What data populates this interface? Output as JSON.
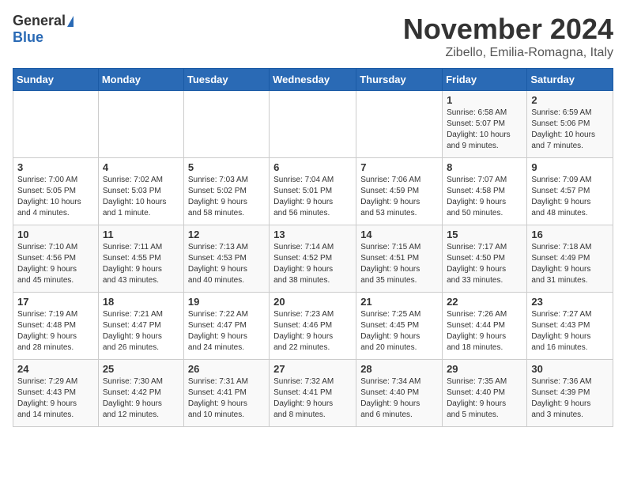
{
  "logo": {
    "general": "General",
    "blue": "Blue"
  },
  "title": "November 2024",
  "subtitle": "Zibello, Emilia-Romagna, Italy",
  "days_of_week": [
    "Sunday",
    "Monday",
    "Tuesday",
    "Wednesday",
    "Thursday",
    "Friday",
    "Saturday"
  ],
  "weeks": [
    [
      {
        "day": "",
        "info": ""
      },
      {
        "day": "",
        "info": ""
      },
      {
        "day": "",
        "info": ""
      },
      {
        "day": "",
        "info": ""
      },
      {
        "day": "",
        "info": ""
      },
      {
        "day": "1",
        "info": "Sunrise: 6:58 AM\nSunset: 5:07 PM\nDaylight: 10 hours\nand 9 minutes."
      },
      {
        "day": "2",
        "info": "Sunrise: 6:59 AM\nSunset: 5:06 PM\nDaylight: 10 hours\nand 7 minutes."
      }
    ],
    [
      {
        "day": "3",
        "info": "Sunrise: 7:00 AM\nSunset: 5:05 PM\nDaylight: 10 hours\nand 4 minutes."
      },
      {
        "day": "4",
        "info": "Sunrise: 7:02 AM\nSunset: 5:03 PM\nDaylight: 10 hours\nand 1 minute."
      },
      {
        "day": "5",
        "info": "Sunrise: 7:03 AM\nSunset: 5:02 PM\nDaylight: 9 hours\nand 58 minutes."
      },
      {
        "day": "6",
        "info": "Sunrise: 7:04 AM\nSunset: 5:01 PM\nDaylight: 9 hours\nand 56 minutes."
      },
      {
        "day": "7",
        "info": "Sunrise: 7:06 AM\nSunset: 4:59 PM\nDaylight: 9 hours\nand 53 minutes."
      },
      {
        "day": "8",
        "info": "Sunrise: 7:07 AM\nSunset: 4:58 PM\nDaylight: 9 hours\nand 50 minutes."
      },
      {
        "day": "9",
        "info": "Sunrise: 7:09 AM\nSunset: 4:57 PM\nDaylight: 9 hours\nand 48 minutes."
      }
    ],
    [
      {
        "day": "10",
        "info": "Sunrise: 7:10 AM\nSunset: 4:56 PM\nDaylight: 9 hours\nand 45 minutes."
      },
      {
        "day": "11",
        "info": "Sunrise: 7:11 AM\nSunset: 4:55 PM\nDaylight: 9 hours\nand 43 minutes."
      },
      {
        "day": "12",
        "info": "Sunrise: 7:13 AM\nSunset: 4:53 PM\nDaylight: 9 hours\nand 40 minutes."
      },
      {
        "day": "13",
        "info": "Sunrise: 7:14 AM\nSunset: 4:52 PM\nDaylight: 9 hours\nand 38 minutes."
      },
      {
        "day": "14",
        "info": "Sunrise: 7:15 AM\nSunset: 4:51 PM\nDaylight: 9 hours\nand 35 minutes."
      },
      {
        "day": "15",
        "info": "Sunrise: 7:17 AM\nSunset: 4:50 PM\nDaylight: 9 hours\nand 33 minutes."
      },
      {
        "day": "16",
        "info": "Sunrise: 7:18 AM\nSunset: 4:49 PM\nDaylight: 9 hours\nand 31 minutes."
      }
    ],
    [
      {
        "day": "17",
        "info": "Sunrise: 7:19 AM\nSunset: 4:48 PM\nDaylight: 9 hours\nand 28 minutes."
      },
      {
        "day": "18",
        "info": "Sunrise: 7:21 AM\nSunset: 4:47 PM\nDaylight: 9 hours\nand 26 minutes."
      },
      {
        "day": "19",
        "info": "Sunrise: 7:22 AM\nSunset: 4:47 PM\nDaylight: 9 hours\nand 24 minutes."
      },
      {
        "day": "20",
        "info": "Sunrise: 7:23 AM\nSunset: 4:46 PM\nDaylight: 9 hours\nand 22 minutes."
      },
      {
        "day": "21",
        "info": "Sunrise: 7:25 AM\nSunset: 4:45 PM\nDaylight: 9 hours\nand 20 minutes."
      },
      {
        "day": "22",
        "info": "Sunrise: 7:26 AM\nSunset: 4:44 PM\nDaylight: 9 hours\nand 18 minutes."
      },
      {
        "day": "23",
        "info": "Sunrise: 7:27 AM\nSunset: 4:43 PM\nDaylight: 9 hours\nand 16 minutes."
      }
    ],
    [
      {
        "day": "24",
        "info": "Sunrise: 7:29 AM\nSunset: 4:43 PM\nDaylight: 9 hours\nand 14 minutes."
      },
      {
        "day": "25",
        "info": "Sunrise: 7:30 AM\nSunset: 4:42 PM\nDaylight: 9 hours\nand 12 minutes."
      },
      {
        "day": "26",
        "info": "Sunrise: 7:31 AM\nSunset: 4:41 PM\nDaylight: 9 hours\nand 10 minutes."
      },
      {
        "day": "27",
        "info": "Sunrise: 7:32 AM\nSunset: 4:41 PM\nDaylight: 9 hours\nand 8 minutes."
      },
      {
        "day": "28",
        "info": "Sunrise: 7:34 AM\nSunset: 4:40 PM\nDaylight: 9 hours\nand 6 minutes."
      },
      {
        "day": "29",
        "info": "Sunrise: 7:35 AM\nSunset: 4:40 PM\nDaylight: 9 hours\nand 5 minutes."
      },
      {
        "day": "30",
        "info": "Sunrise: 7:36 AM\nSunset: 4:39 PM\nDaylight: 9 hours\nand 3 minutes."
      }
    ]
  ]
}
